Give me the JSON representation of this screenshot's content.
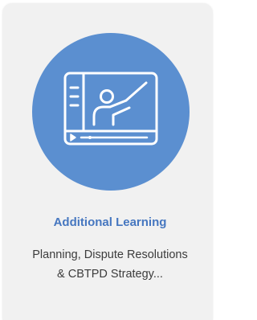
{
  "card": {
    "title": "Additional Learning",
    "description": "Planning, Dispute Resolutions & CBTPD Strategy...",
    "icon": "video-lesson-icon",
    "colors": {
      "icon_circle": "#5b8fd0",
      "title": "#4677c0",
      "description": "#3c3c3c",
      "card_background": "#f1f1f1"
    }
  }
}
